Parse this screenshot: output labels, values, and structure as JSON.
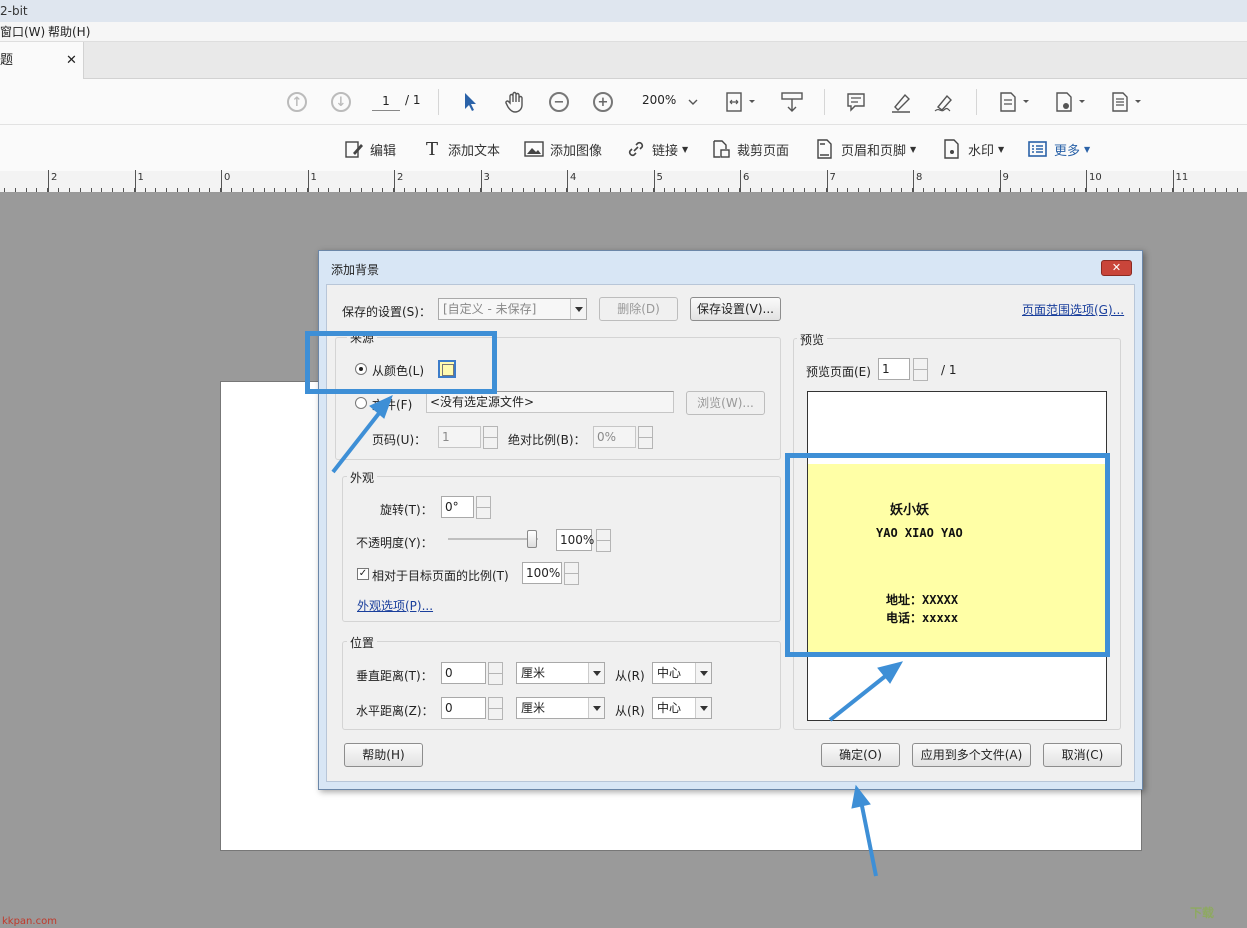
{
  "window": {
    "title": "2-bit"
  },
  "menu": {
    "window_label": "窗口(W)",
    "help_label": "帮助(H)"
  },
  "tab": {
    "title": "题",
    "close": "✕"
  },
  "nav": {
    "page_current": "1",
    "page_total": "/ 1",
    "zoom": "200%"
  },
  "toolbar": {
    "edit": "编辑",
    "add_text": "添加文本",
    "add_image": "添加图像",
    "link": "链接",
    "crop": "裁剪页面",
    "header_footer": "页眉和页脚",
    "watermark": "水印",
    "more": "更多"
  },
  "ruler": {
    "labels": [
      "2",
      "1",
      "0",
      "1",
      "2",
      "3",
      "4",
      "5",
      "6",
      "7",
      "8",
      "9",
      "10",
      "11"
    ]
  },
  "dialog": {
    "title": "添加背景",
    "close": "✕",
    "saved_settings_label": "保存的设置(S)：",
    "saved_settings_value": "[自定义 - 未保存]",
    "delete_button": "删除(D)",
    "save_settings_button": "保存设置(V)...",
    "page_range_link": "页面范围选项(G)...",
    "source": {
      "title": "来源",
      "from_color": "从颜色(L)",
      "file_label": "文件(F)",
      "file_placeholder": "<没有选定源文件>",
      "browse_button": "浏览(W)...",
      "page_num_label": "页码(U)：",
      "page_num_value": "1",
      "abs_scale_label": "绝对比例(B)：",
      "abs_scale_value": "0%"
    },
    "appearance": {
      "title": "外观",
      "rotation_label": "旋转(T)：",
      "rotation_value": "0°",
      "opacity_label": "不透明度(Y)：",
      "opacity_value": "100%",
      "relative_label": "相对于目标页面的比例(T)",
      "relative_value": "100%",
      "options_link": "外观选项(P)..."
    },
    "position": {
      "title": "位置",
      "vertical_label": "垂直距离(T)：",
      "vertical_value": "0",
      "vertical_unit": "厘米",
      "vertical_from_label": "从(R)",
      "vertical_from_value": "中心",
      "horizontal_label": "水平距离(Z)：",
      "horizontal_value": "0",
      "horizontal_unit": "厘米",
      "horizontal_from_label": "从(R)",
      "horizontal_from_value": "中心"
    },
    "preview": {
      "title": "预览",
      "page_label": "预览页面(E)",
      "page_value": "1",
      "page_total": "/ 1",
      "line1": "妖小妖",
      "line2": "YAO XIAO YAO",
      "address": "地址：XXXXX",
      "phone": "电话：xxxxx"
    },
    "help_button": "帮助(H)",
    "ok_button": "确定(O)",
    "apply_multi_button": "应用到多个文件(A)",
    "cancel_button": "取消(C)"
  },
  "watermarks": {
    "left": "kkpan.com",
    "right": "下载"
  },
  "colors": {
    "highlight": "#3e8fd6",
    "preview_fill": "#ffffa6",
    "close_red": "#c9453a"
  }
}
